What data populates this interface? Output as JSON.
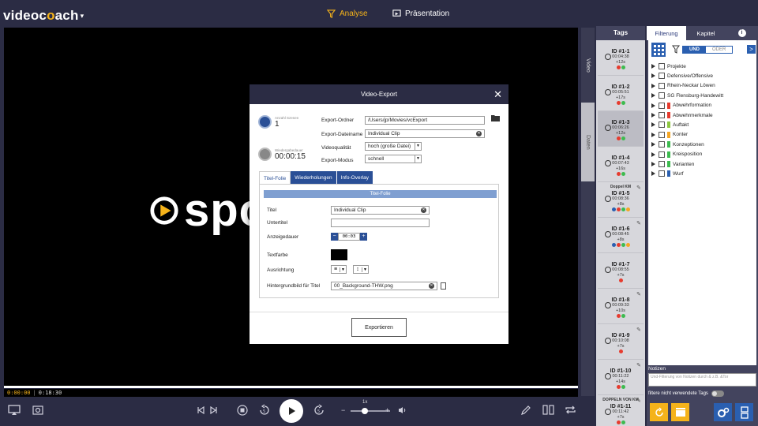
{
  "app": {
    "logo_a": "video",
    "logo_b": "c",
    "logo_c": "o",
    "logo_d": "ach"
  },
  "nav": {
    "analyse": "Analyse",
    "praesentation": "Präsentation"
  },
  "video": {
    "logo_text": "spor",
    "time_current": "0:00:00",
    "time_total": "0:18:30",
    "speed": "1x"
  },
  "sidestrip": {
    "video": "Video",
    "daten": "Daten"
  },
  "tags": {
    "header": "Tags",
    "items": [
      {
        "pre": "",
        "id": "ID #1-1",
        "time": "00:04:38",
        "dur": "+12s",
        "dots": [
          "#e63b2e",
          "#3dbb4f"
        ],
        "selected": false,
        "pen": false
      },
      {
        "pre": "",
        "id": "ID #1-2",
        "time": "00:05:51",
        "dur": "+17s",
        "dots": [
          "#e63b2e",
          "#3dbb4f"
        ],
        "selected": false,
        "pen": false
      },
      {
        "pre": "",
        "id": "ID #1-3",
        "time": "00:06:26",
        "dur": "+12s",
        "dots": [
          "#e63b2e",
          "#3dbb4f"
        ],
        "selected": true,
        "pen": false
      },
      {
        "pre": "",
        "id": "ID #1-4",
        "time": "00:07:43",
        "dur": "+16s",
        "dots": [
          "#e63b2e",
          "#3dbb4f"
        ],
        "selected": false,
        "pen": false
      },
      {
        "pre": "Doppel KM",
        "id": "ID #1-5",
        "time": "00:08:36",
        "dur": "+8s",
        "dots": [
          "#2a5fb0",
          "#e63b2e",
          "#3dbb4f",
          "#f5a623"
        ],
        "selected": false,
        "pen": true
      },
      {
        "pre": "",
        "id": "ID #1-6",
        "time": "00:08:45",
        "dur": "+8s",
        "dots": [
          "#2a5fb0",
          "#e63b2e",
          "#3dbb4f",
          "#f5a623"
        ],
        "selected": false,
        "pen": true
      },
      {
        "pre": "",
        "id": "ID #1-7",
        "time": "00:08:55",
        "dur": "+7s",
        "dots": [
          "#e63b2e"
        ],
        "selected": false,
        "pen": false
      },
      {
        "pre": "",
        "id": "ID #1-8",
        "time": "00:09:33",
        "dur": "+10s",
        "dots": [
          "#e63b2e",
          "#3dbb4f"
        ],
        "selected": false,
        "pen": true
      },
      {
        "pre": "",
        "id": "ID #1-9",
        "time": "00:10:08",
        "dur": "+7s",
        "dots": [
          "#e63b2e"
        ],
        "selected": false,
        "pen": true
      },
      {
        "pre": "",
        "id": "ID #1-10",
        "time": "00:11:22",
        "dur": "+14s",
        "dots": [
          "#e63b2e",
          "#3dbb4f"
        ],
        "selected": false,
        "pen": true
      },
      {
        "pre": "DOPPELN VON KM",
        "id": "ID #1-11",
        "time": "00:11:42",
        "dur": "+7s",
        "dots": [
          "#e63b2e",
          "#3dbb4f"
        ],
        "selected": false,
        "pen": true
      }
    ]
  },
  "filter": {
    "tab_filter": "Filterung",
    "tab_kapitel": "Kapitel",
    "tab_info": "i",
    "und": "UND",
    "oder": "ODER",
    "next": ">",
    "items": [
      {
        "label": "Projekte",
        "swatch": ""
      },
      {
        "label": "Defensive/Offensive",
        "swatch": ""
      },
      {
        "label": "Rhein-Neckar Löwen",
        "swatch": ""
      },
      {
        "label": "SG Flensburg-Handewitt",
        "swatch": ""
      },
      {
        "label": "Abwehrformation",
        "swatch": "#e63b2e"
      },
      {
        "label": "Abwehrmerkmale",
        "swatch": "#e63b2e"
      },
      {
        "label": "Auftakt",
        "swatch": "#8dc63f"
      },
      {
        "label": "Konter",
        "swatch": "#f5a623"
      },
      {
        "label": "Konzeptionen",
        "swatch": "#3dbb4f"
      },
      {
        "label": "Kreisposition",
        "swatch": "#3dbb4f"
      },
      {
        "label": "Varianten",
        "swatch": "#3dbb4f"
      },
      {
        "label": "Wurf",
        "swatch": "#2a5fb0"
      }
    ],
    "notizen_label": "Notizen",
    "notizen_placeholder": "Und-Filterung von Notizen durch & z.B. &Tor",
    "unused_label": "filtere nicht verwendete Tags"
  },
  "modal": {
    "title": "Video-Export",
    "close": "✕",
    "scenes_label": "Anzahl Szenen",
    "scenes_value": "1",
    "duration_label": "Wiedergabedauer",
    "duration_value": "00:00:15",
    "folder_label": "Export-Ordner",
    "folder_value": "/Users/jp/Movies/vcExport",
    "filename_label": "Export-Dateiname",
    "filename_value": "Individual Clip",
    "quality_label": "Videoqualität",
    "quality_value": "hoch (große Datei)",
    "mode_label": "Export-Modus",
    "mode_value": "schnell",
    "tabs": [
      "Titel-Folie",
      "Wiederholungen",
      "Info-Overlay"
    ],
    "panel_header": "Titel-Folie",
    "titel_label": "Titel",
    "titel_value": "Individual Clip",
    "untertitel_label": "Untertitel",
    "untertitel_value": "",
    "anzeige_label": "Anzeigedauer",
    "anzeige_value": "00:03",
    "textfarbe_label": "Textfarbe",
    "textfarbe_color": "#000000",
    "ausrichtung_label": "Ausrichtung",
    "bg_label": "Hintergrundbild für Titel",
    "bg_value": "00_Background-THW.png",
    "export_button": "Exportieren"
  }
}
